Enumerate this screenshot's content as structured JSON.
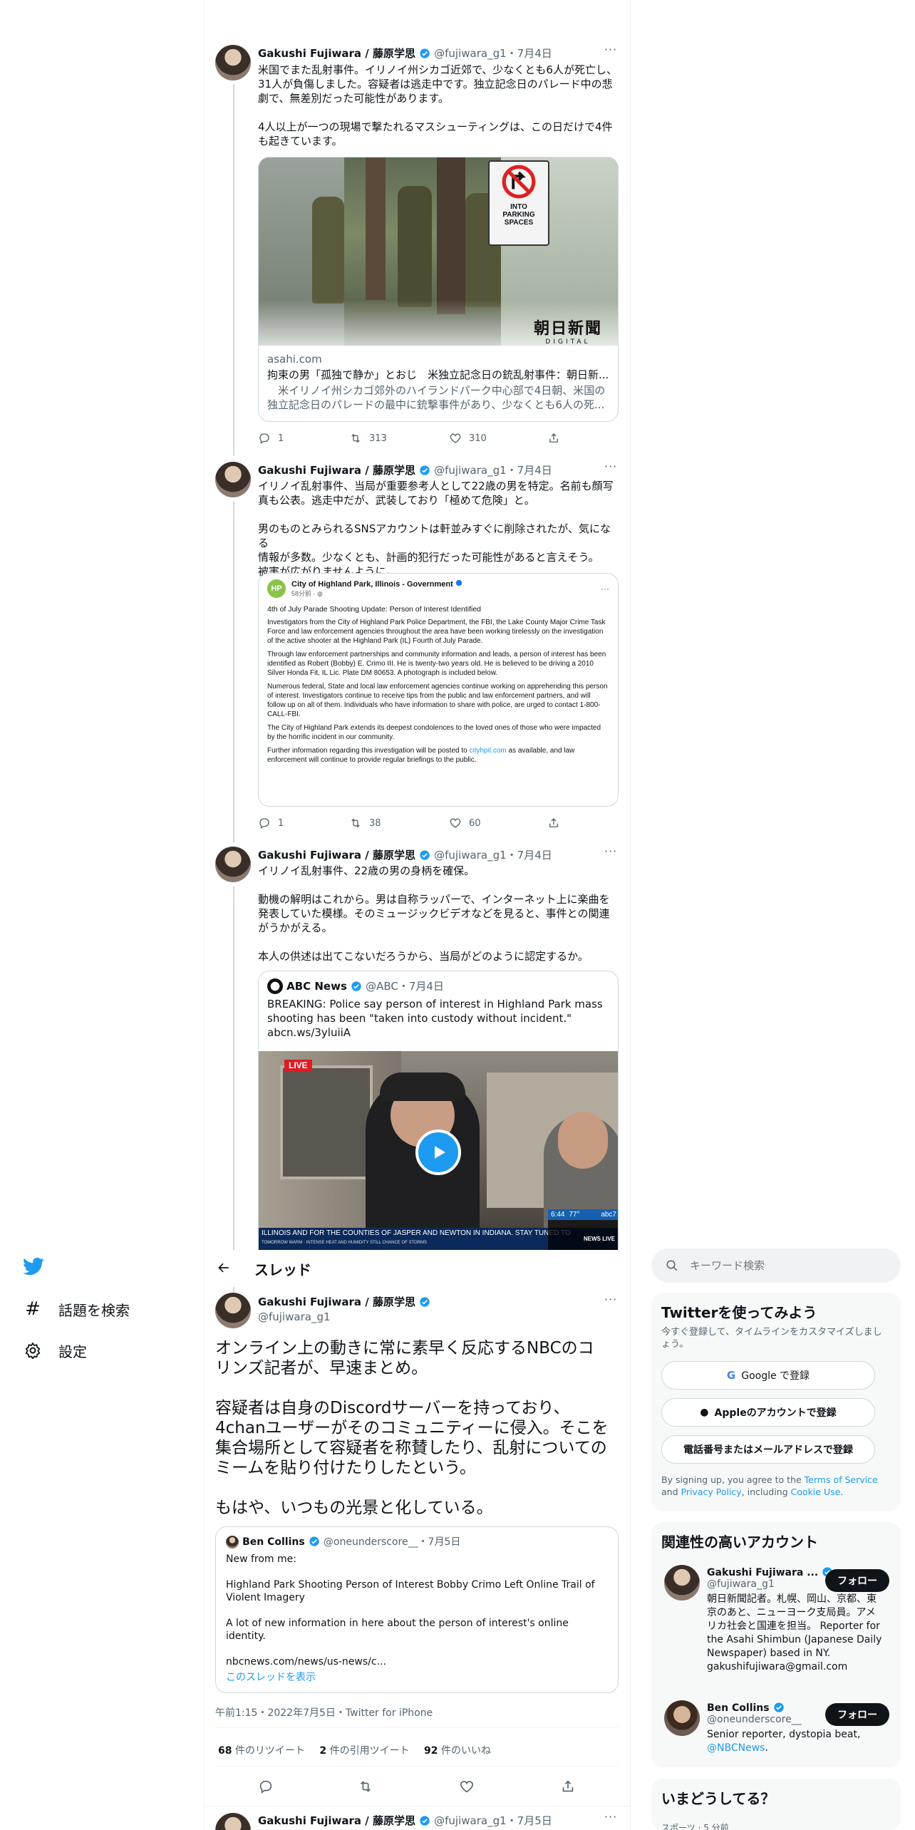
{
  "colors": {
    "accent": "#1d9bf0",
    "text": "#0f1419",
    "muted": "#536471",
    "border": "#cfd9de"
  },
  "nav": {
    "logo_icon": "twitter-bird-icon",
    "explore_label": "話題を検索",
    "settings_label": "設定"
  },
  "header": {
    "back_icon": "arrow-left-icon",
    "title": "スレッド"
  },
  "search": {
    "placeholder": "キーワード検索"
  },
  "tweets": [
    {
      "name": "Gakushi Fujiwara / 藤原学思",
      "handle": "@fujiwara_g1",
      "date": "・7月4日",
      "text": "米国でまた乱射事件。イリノイ州シカゴ近郊で、少なくとも6人が死亡し、\n31人が負傷しました。容疑者は逃走中です。独立記念日のパレード中の悲\n劇で、無差別だった可能性があります。\n\n4人以上が一つの現場で撃たれるマスシューティングは、この日だけで4件\nも起きています。",
      "card": {
        "domain": "asahi.com",
        "title": "拘束の男「孤独で静か」とおじ　米独立記念日の銃乱射事件：朝日新...",
        "desc": "　米イリノイ州シカゴ郊外のハイランドパーク中心部で4日朝、米国の\n独立記念日のパレードの最中に銃撃事件があり、少なくとも6人の死...",
        "logo_main": "朝日新聞",
        "logo_sub": "DIGITAL",
        "sign_text": "INTO\nPARKING\nSPACES"
      },
      "replies": "1",
      "retweets": "313",
      "likes": "310"
    },
    {
      "name": "Gakushi Fujiwara / 藤原学思",
      "handle": "@fujiwara_g1",
      "date": "・7月4日",
      "text": "イリノイ乱射事件、当局が重要参考人として22歳の男を特定。名前も顔写\n真も公表。逃走中だが、武装しており「極めて危険」と。\n\n男のものとみられるSNSアカウントは軒並みすぐに削除されたが、気になる\n情報が多数。少なくとも、計画的犯行だった可能性があると言えそう。\n被害が広がりませんように。",
      "embed": {
        "page_name": "City of Highland Park, Illinois - Government",
        "time": "58分前 · ",
        "heading": "4th of July Parade Shooting Update: Person of Interest Identified",
        "p1": "Investigators from the City of Highland Park Police Department, the FBI, the Lake County Major Crime Task Force and law enforcement agencies throughout the area have been working tirelessly on the investigation of the active shooter at the Highland Park (IL) Fourth of July Parade.",
        "p2": "Through law enforcement partnerships and community information and leads, a person of interest has been identified as Robert (Bobby) E. Crimo III.  He is twenty-two years old.  He is believed to be driving a 2010 Silver Honda Fit, IL Lic. Plate DM 80653.  A photograph is included below.",
        "p3": "Numerous federal, State and local law enforcement agencies continue working on apprehending this person of interest.  Investigators continue to receive tips from the public and law enforcement partners, and will follow up on all of them.  Individuals who have information to share with police, are urged to contact 1-800-CALL-FBI.",
        "p4": "The City of Highland Park extends its deepest condolences to the loved ones of those who were impacted by the horrific incident in our community.",
        "p5_before": "Further information regarding this investigation will be posted to ",
        "p5_link": "cityhpil.com",
        "p5_after": " as available, and law enforcement will continue to provide regular briefings to the public."
      },
      "replies": "1",
      "retweets": "38",
      "likes": "60"
    },
    {
      "name": "Gakushi Fujiwara / 藤原学思",
      "handle": "@fujiwara_g1",
      "date": "・7月4日",
      "text": "イリノイ乱射事件、22歳の男の身柄を確保。\n\n動機の解明はこれから。男は自称ラッパーで、インターネット上に楽曲を\n発表していた模様。そのミュージックビデオなどを見ると、事件との関連\nがうかがえる。\n\n本人の供述は出てこないだろうから、当局がどのように認定するか。",
      "quote": {
        "name": "ABC News",
        "handle": "@ABC",
        "date": "・7月4日",
        "text": "BREAKING: Police say person of interest in Highland Park mass\nshooting has been \"taken into custody without incident.\"\nabcn.ws/3yluiiA",
        "live": "LIVE",
        "ticker": "ILLINOIS AND FOR THE COUNTIES OF JASPER AND NEWTON IN INDIANA. STAY TUNED TO",
        "ticker2": "TOMORROW    WARM · INTENSE HEAT AND HUMIDITY STILL CHANCE OF STORMS",
        "time": "6:44",
        "temp": "77°",
        "channel": "abc7",
        "news_live": "NEWS LIVE"
      }
    }
  ],
  "main_tweet": {
    "name": "Gakushi Fujiwara / 藤原学思",
    "handle": "@fujiwara_g1",
    "text": "オンライン上の動きに常に素早く反応するNBCのコ\nリンズ記者が、早速まとめ。\n\n容疑者は自身のDiscordサーバーを持っており、\n4chanユーザーがそのコミュニティーに侵入。そこを\n集合場所として容疑者を称賛したり、乱射についての\nミームを貼り付けたりしたという。\n\nもはや、いつもの光景と化している。",
    "quote": {
      "name": "Ben Collins",
      "handle": "@oneunderscore__",
      "date": "・7月5日",
      "text": "New from me:\n\nHighland Park Shooting Person of Interest Bobby Crimo Left Online Trail of\nViolent Imagery\n\nA lot of new information in here about the person of interest's online identity.\n\nnbcnews.com/news/us-news/c...",
      "show_thread": "このスレッドを表示"
    },
    "meta": "午前1:15・2022年7月5日・Twitter for iPhone",
    "retweet_count": "68",
    "retweet_label": " 件のリツイート",
    "quote_count": "2",
    "quote_label": " 件の引用ツイート",
    "like_count": "92",
    "like_label": " 件のいいね"
  },
  "next_tweet": {
    "name": "Gakushi Fujiwara / 藤原学思",
    "handle": "@fujiwara_g1",
    "date": "・7月5日"
  },
  "signup": {
    "title": "Twitterを使ってみよう",
    "subtitle": "今すぐ登録して、タイムラインをカスタマイズしましょう。",
    "google": "Google で登録",
    "apple": "Appleのアカウントで登録",
    "phone": "電話番号またはメールアドレスで登録",
    "terms_before": "By signing up, you agree to the ",
    "terms_link": "Terms of Service",
    "terms_and": " and ",
    "privacy_link": "Privacy Policy",
    "terms_including": ", including ",
    "cookie_link": "Cookie Use",
    "terms_end": "."
  },
  "relevant": {
    "title": "関連性の高いアカウント",
    "accounts": [
      {
        "name": "Gakushi Fujiwara ...",
        "handle": "@fujiwara_g1",
        "follow": "フォロー",
        "bio": "朝日新聞記者。札幌、岡山、京都、東\n京のあと、ニューヨーク支局員。アメ\nリカ社会と国連を担当。 Reporter for\nthe Asahi Shimbun (Japanese Daily\nNewspaper) based in NY.\ngakushifujiwara@gmail.com"
      },
      {
        "name": "Ben Collins",
        "handle": "@oneunderscore__",
        "follow": "フォロー",
        "bio": "Senior reporter, dystopia beat,",
        "bio_link": "@NBCNews",
        "bio_end": "."
      }
    ]
  },
  "trends": {
    "title": "いまどうしてる？",
    "sub": "スポーツ · 5 分前"
  }
}
